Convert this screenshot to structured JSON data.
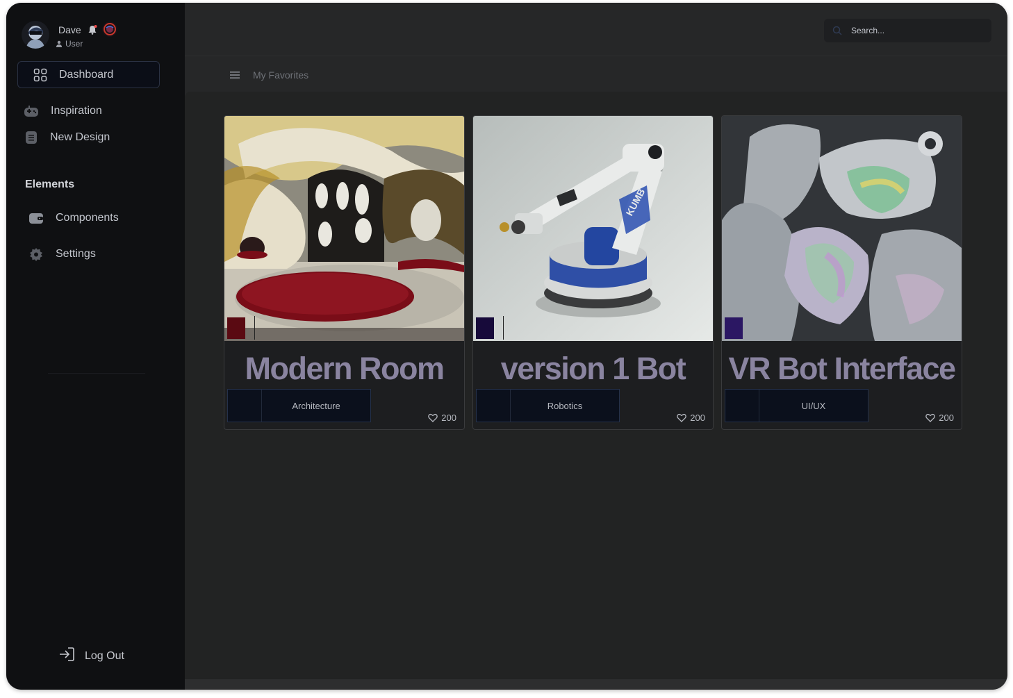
{
  "user": {
    "name": "Dave",
    "role": "User"
  },
  "nav": {
    "dashboard": "Dashboard",
    "inspiration": "Inspiration",
    "new_design": "New Design",
    "section_elements": "Elements",
    "components": "Components",
    "settings": "Settings",
    "logout": "Log Out"
  },
  "search": {
    "placeholder": "Search..."
  },
  "breadcrumb": "My Favorites",
  "cards": [
    {
      "title": "Modern Room",
      "tag": "Architecture",
      "likes": "200",
      "swatch": "#5a0a12"
    },
    {
      "title": "version 1 Bot",
      "tag": "Robotics",
      "likes": "200",
      "swatch": "#170a3a"
    },
    {
      "title": "VR Bot Interface",
      "tag": "UI/UX",
      "likes": "200",
      "swatch": "#2b1763"
    }
  ],
  "colors": {
    "sidebar": "#0f1012",
    "background": "#262728",
    "accent": "#2a3143"
  }
}
